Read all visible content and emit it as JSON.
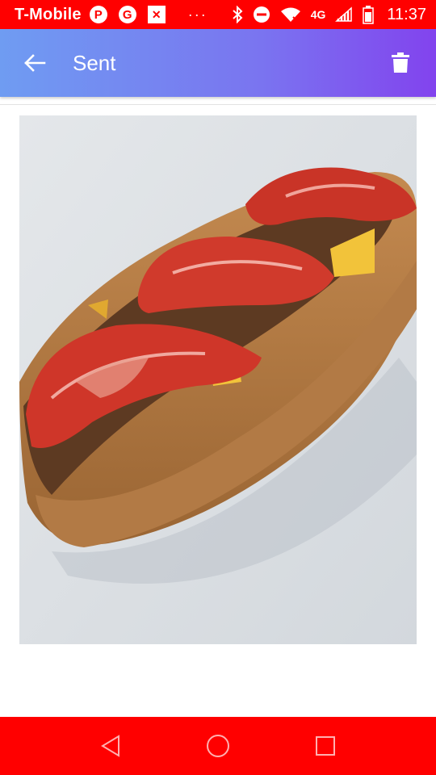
{
  "status_bar": {
    "carrier": "T-Mobile",
    "left_icons": [
      "pinterest-icon",
      "google-icon",
      "fitness-app-icon"
    ],
    "overflow": "···",
    "network": "4G",
    "time": "11:37"
  },
  "app_bar": {
    "title": "Sent",
    "back_icon": "arrow-back-icon",
    "action_icon": "trash-icon"
  },
  "content": {
    "image": "sent-photo"
  },
  "nav_bar": {
    "buttons": [
      "back-triangle",
      "home-circle",
      "recents-square"
    ]
  },
  "colors": {
    "status_bar": "#ff0000",
    "app_bar_start": "#6f9cf2",
    "app_bar_end": "#8243ee",
    "nav_bar": "#ff0000"
  }
}
